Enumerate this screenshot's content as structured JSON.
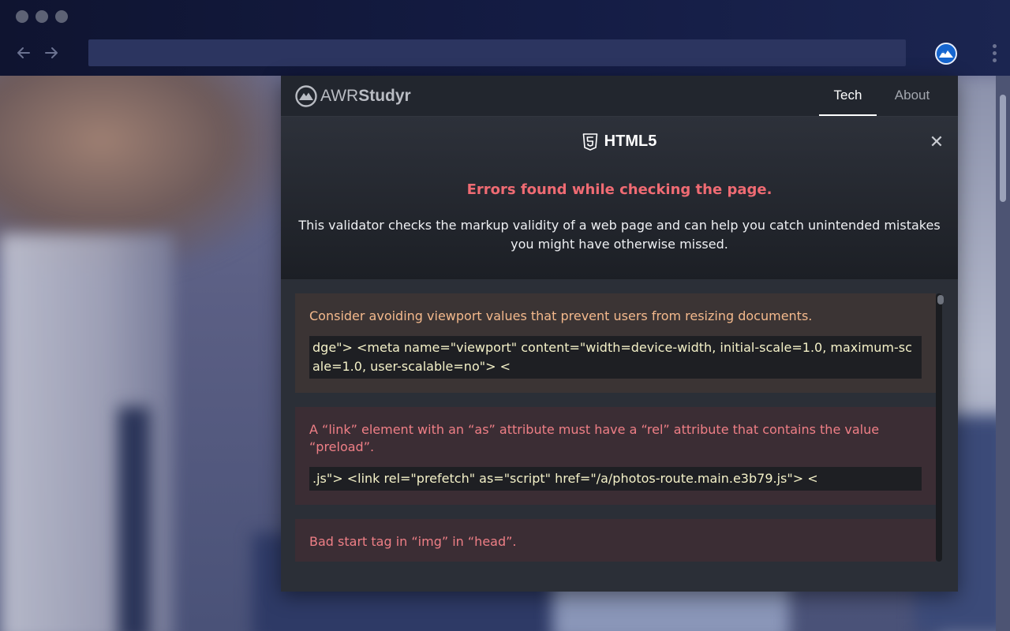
{
  "browser": {
    "back_icon": "arrow-left-icon",
    "forward_icon": "arrow-right-icon",
    "extension_icon": "awrstudyr-extension-icon",
    "menu_icon": "kebab-menu-icon"
  },
  "popup": {
    "brand": {
      "light": "AWR",
      "bold": "Studyr"
    },
    "tabs": [
      {
        "label": "Tech",
        "active": true
      },
      {
        "label": "About",
        "active": false
      }
    ],
    "panel": {
      "title": "HTML5",
      "title_icon": "html5-shield-icon",
      "close_icon": "close-icon",
      "close_glyph": "✕"
    },
    "error_heading": "Errors found while checking the page.",
    "description": "This validator checks the markup validity of a web page and can help you catch unintended mistakes you might have otherwise missed.",
    "messages": [
      {
        "type": "warning",
        "text": "Consider avoiding viewport values that prevent users from resizing documents.",
        "code": "dge\"> <meta name=\"viewport\" content=\"width=device-width, initial-scale=1.0, maximum-scale=1.0, user-scalable=no\"> <"
      },
      {
        "type": "error",
        "text": "A “link” element with an “as” attribute must have a “rel” attribute that contains the value “preload”.",
        "code": ".js\"> <link rel=\"prefetch\" as=\"script\" href=\"/a/photos-route.main.e3b79.js\"> <"
      },
      {
        "type": "error",
        "text": "Bad start tag in “img” in “head”.",
        "code": ""
      }
    ]
  },
  "colors": {
    "error_heading": "#ef6b73",
    "warning_text": "#f4b98c",
    "error_text": "#ef7f86",
    "code_text": "#f4f1c8"
  }
}
